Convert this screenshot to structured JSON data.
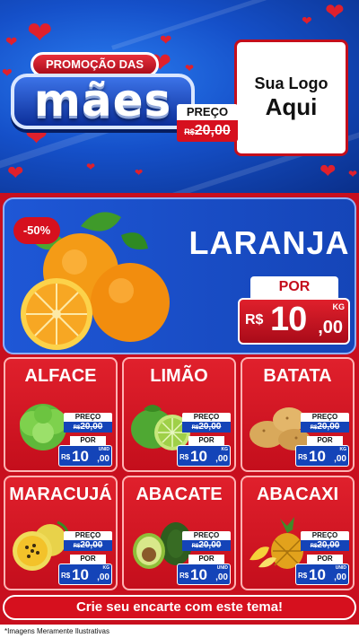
{
  "header": {
    "badge_top": "PROMOÇÃO DAS",
    "badge_main": "mães",
    "logo_line1": "Sua Logo",
    "logo_line2": "Aqui"
  },
  "featured": {
    "discount": "-50%",
    "name": "LARANJA",
    "price_label": "PREÇO",
    "old_currency": "R$",
    "old_value": "20,00",
    "por_label": "POR",
    "new_currency": "R$",
    "new_int": "10",
    "new_dec": ",00",
    "unit": "KG"
  },
  "products": [
    {
      "name": "ALFACE",
      "price_label": "PREÇO",
      "old_currency": "R$",
      "old_value": "20,00",
      "por_label": "POR",
      "currency": "R$",
      "new_int": "10",
      "new_dec": ",00",
      "unit": "UNID"
    },
    {
      "name": "LIMÃO",
      "price_label": "PREÇO",
      "old_currency": "R$",
      "old_value": "20,00",
      "por_label": "POR",
      "currency": "R$",
      "new_int": "10",
      "new_dec": ",00",
      "unit": "KG"
    },
    {
      "name": "BATATA",
      "price_label": "PREÇO",
      "old_currency": "R$",
      "old_value": "20,00",
      "por_label": "POR",
      "currency": "R$",
      "new_int": "10",
      "new_dec": ",00",
      "unit": "KG"
    },
    {
      "name": "MARACUJÁ",
      "price_label": "PREÇO",
      "old_currency": "R$",
      "old_value": "20,00",
      "por_label": "POR",
      "currency": "R$",
      "new_int": "10",
      "new_dec": ",00",
      "unit": "KG"
    },
    {
      "name": "ABACATE",
      "price_label": "PREÇO",
      "old_currency": "R$",
      "old_value": "20,00",
      "por_label": "POR",
      "currency": "R$",
      "new_int": "10",
      "new_dec": ",00",
      "unit": "UNID"
    },
    {
      "name": "ABACAXI",
      "price_label": "PREÇO",
      "old_currency": "R$",
      "old_value": "20,00",
      "por_label": "POR",
      "currency": "R$",
      "new_int": "10",
      "new_dec": ",00",
      "unit": "UNID"
    }
  ],
  "footer": {
    "cta": "Crie seu encarte com este tema!",
    "disclaimer": "*Imagens Meramente Ilustrativas"
  },
  "colors": {
    "brand_red": "#d6101e",
    "brand_blue": "#1545b8",
    "header_blue": "#1550c9"
  }
}
